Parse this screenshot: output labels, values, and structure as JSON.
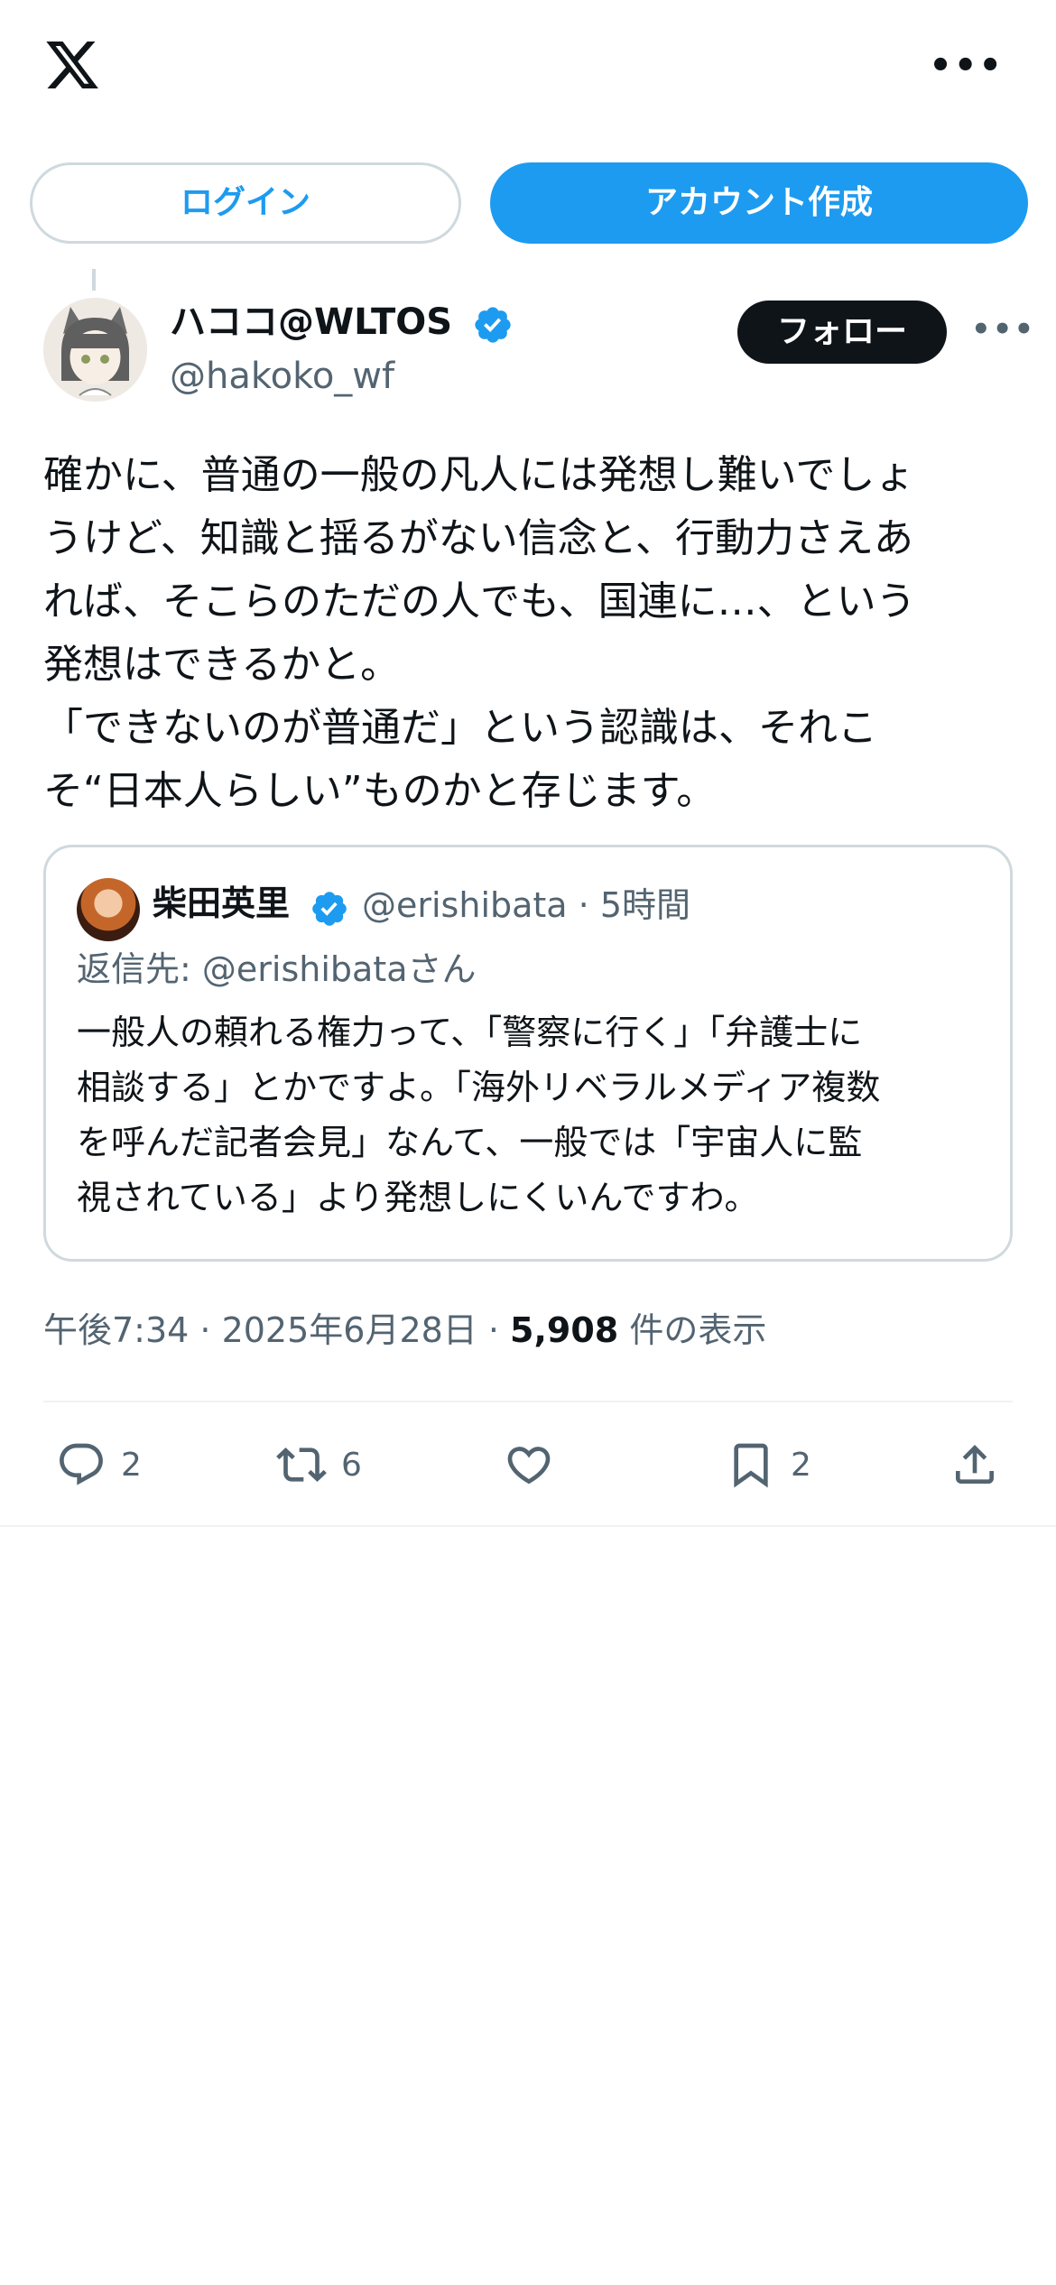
{
  "header": {
    "logo_icon": "x-logo-icon",
    "more_icon": "more-horizontal-icon",
    "more_label": "•••"
  },
  "auth": {
    "login_label": "ログイン",
    "signup_label": "アカウント作成"
  },
  "tweet": {
    "author_name": "ハココ@WLTOS",
    "author_handle": "@hakoko_wf",
    "follow_label": "フォロー",
    "more_label": "•••",
    "text": "確かに、普通の一般の凡人には発想し難いでしょ\nうけど、知識と揺るがない信念と、行動力さえあ\nれば、そこらのただの人でも、国連に…、という\n発想はできるかと。\n「できないのが普通だ」という認識は、それこ\nそ“日本人らしい”ものかと存じます。",
    "timestamp": "午後7:34 · 2025年6月28日 · ",
    "views_count": "5,908",
    "views_label": " 件の表示"
  },
  "quote": {
    "author_name": "柴田英里",
    "author_handle": "@erishibata · 5時間",
    "reply_to": "返信先: @erishibataさん",
    "text": "一般人の頼れる権力って、「警察に行く」「弁護士に\n相談する」とかですよ。「海外リベラルメディア複数\nを呼んだ記者会見」なんて、一般では「宇宙人に監\n視されている」より発想しにくいんですわ。"
  },
  "actions": {
    "reply_count": "2",
    "retweet_count": "6",
    "like_count": "",
    "bookmark_count": "2"
  },
  "colors": {
    "accent": "#1d9bf0",
    "text": "#0f1419",
    "secondary": "#536471",
    "border": "#cfd9de"
  }
}
